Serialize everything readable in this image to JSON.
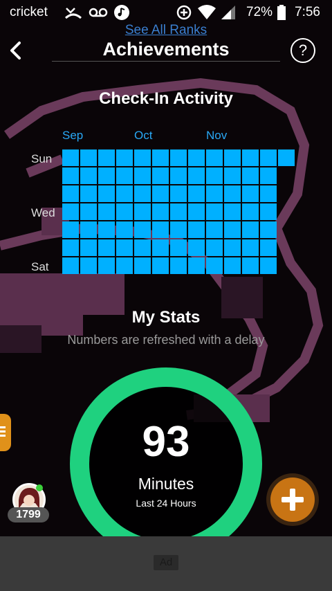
{
  "status_bar": {
    "carrier": "cricket",
    "battery_percent": "72%",
    "time": "7:56"
  },
  "link_above": "See All Ranks",
  "header": {
    "title": "Achievements",
    "help_label": "?"
  },
  "checkin": {
    "title": "Check-In Activity",
    "months": [
      "Sep",
      "Oct",
      "Nov"
    ],
    "day_labels": [
      "Sun",
      "Wed",
      "Sat"
    ],
    "weeks_full": 12,
    "last_week_days": 1,
    "cell_color": "#00b0ff"
  },
  "stats": {
    "title": "My Stats",
    "subtitle": "Numbers are refreshed with a delay",
    "value": "93",
    "unit": "Minutes",
    "period": "Last 24 Hours",
    "ring_color": "#1fd17f"
  },
  "user": {
    "reputation": "1799"
  },
  "ad": {
    "label": "Ad"
  },
  "colors": {
    "accent_orange": "#c87414",
    "link_blue": "#3a7fd0",
    "background_art": "#6a3a5a"
  }
}
